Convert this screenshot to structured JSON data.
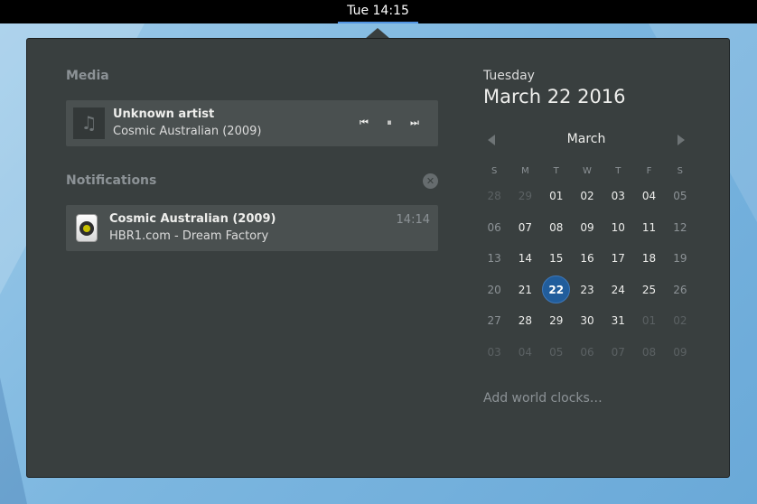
{
  "topbar": {
    "clock": "Tue 14:15"
  },
  "media": {
    "section_title": "Media",
    "art_icon": "music-note-icon",
    "artist": "Unknown artist",
    "album": "Cosmic Australian (2009)",
    "controls": {
      "prev": "⏮",
      "pause": "⏸",
      "next": "⏭"
    }
  },
  "notifications": {
    "section_title": "Notifications",
    "clear_icon": "✕",
    "items": [
      {
        "icon": "speaker-icon",
        "title": "Cosmic Australian (2009)",
        "body": "HBR1.com - Dream Factory",
        "time": "14:14"
      }
    ]
  },
  "calendar": {
    "weekday": "Tuesday",
    "date": "March 22 2016",
    "month": "March",
    "day_headers": [
      "S",
      "M",
      "T",
      "W",
      "T",
      "F",
      "S"
    ],
    "weeks": [
      [
        "28",
        "29",
        "01",
        "02",
        "03",
        "04",
        "05"
      ],
      [
        "06",
        "07",
        "08",
        "09",
        "10",
        "11",
        "12"
      ],
      [
        "13",
        "14",
        "15",
        "16",
        "17",
        "18",
        "19"
      ],
      [
        "20",
        "21",
        "22",
        "23",
        "24",
        "25",
        "26"
      ],
      [
        "27",
        "28",
        "29",
        "30",
        "31",
        "01",
        "02"
      ],
      [
        "03",
        "04",
        "05",
        "06",
        "07",
        "08",
        "09"
      ]
    ],
    "today": "22",
    "world_clocks": "Add world clocks…"
  },
  "colors": {
    "accent": "#215d9c",
    "panel": "#393f3f",
    "card": "#4a5050"
  }
}
